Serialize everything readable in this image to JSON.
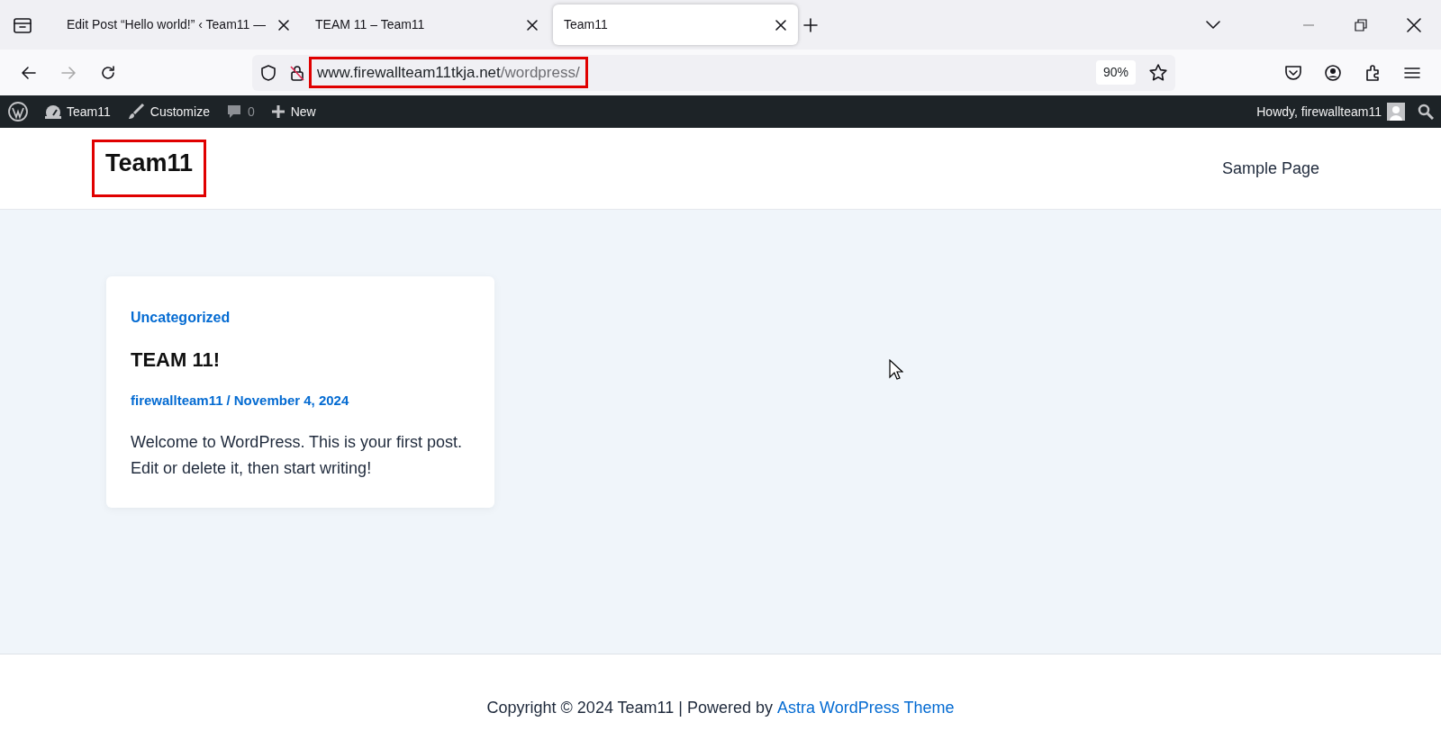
{
  "browser": {
    "tabs": [
      {
        "label": "Edit Post “Hello world!” ‹ Team11 —",
        "selected": false
      },
      {
        "label": "TEAM 11 – Team11",
        "selected": false
      },
      {
        "label": "Team11",
        "selected": true
      }
    ],
    "address": {
      "host": "www.firewallteam11tkja.net",
      "path": "/wordpress/",
      "highlighted": true
    },
    "zoom": "90%"
  },
  "admin_bar": {
    "site": "Team11",
    "customize": "Customize",
    "comments": "0",
    "new": "New",
    "greeting": "Howdy, firewallteam11"
  },
  "header": {
    "site_title": "Team11",
    "site_title_highlighted": true,
    "menu": [
      "Sample Page"
    ]
  },
  "posts": [
    {
      "category": "Uncategorized",
      "title": "TEAM 11!",
      "author": "firewallteam11",
      "separator": "/",
      "date": "November 4, 2024",
      "excerpt": "Welcome to WordPress. This is your first post. Edit or delete it, then start writing!"
    }
  ],
  "footer": {
    "text": "Copyright © 2024 Team11 | Powered by",
    "link": "Astra WordPress Theme"
  }
}
